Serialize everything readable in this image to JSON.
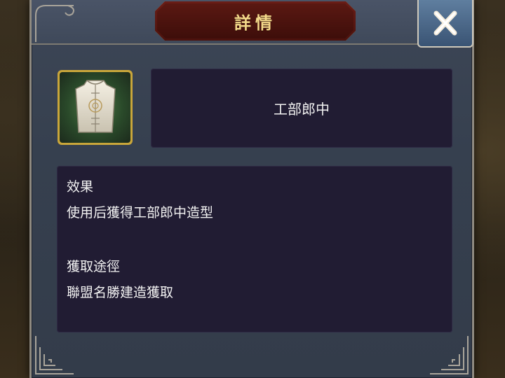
{
  "dialog": {
    "title": "詳情",
    "close_icon": "close-x-icon"
  },
  "item": {
    "icon": "white-robe-costume-icon",
    "name": "工部郎中"
  },
  "description": {
    "effect_heading": "效果",
    "effect_text": "使用后獲得工部郎中造型",
    "source_heading": "獲取途徑",
    "source_text": "聯盟名勝建造獲取"
  },
  "colors": {
    "panel": "#36404f",
    "title_plate": "#5a1812",
    "title_text": "#f4d98a",
    "content_box": "#211c33",
    "item_frame": "#c9a63a"
  }
}
